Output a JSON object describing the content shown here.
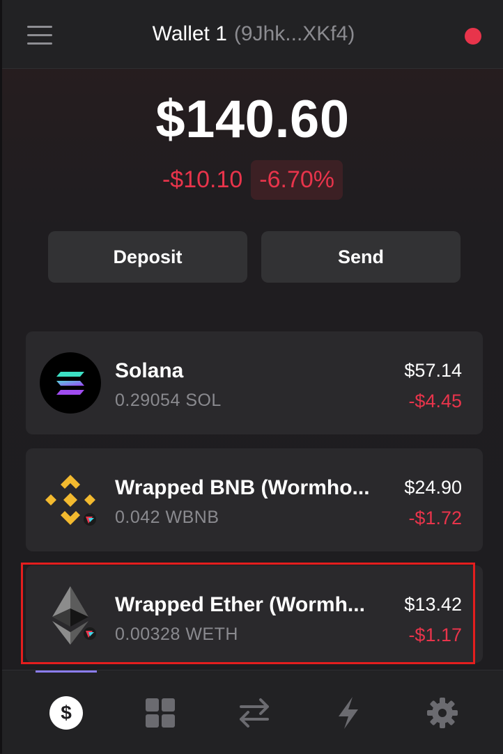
{
  "header": {
    "wallet_name": "Wallet 1",
    "wallet_address": "(9Jhk...XKf4)",
    "status_color": "#e8344b"
  },
  "balance": {
    "total": "$140.60",
    "change_amount": "-$10.10",
    "change_percent": "-6.70%"
  },
  "actions": {
    "deposit_label": "Deposit",
    "send_label": "Send"
  },
  "tokens": [
    {
      "name": "Solana",
      "amount": "0.29054 SOL",
      "value": "$57.14",
      "change": "-$4.45",
      "icon": "solana-icon"
    },
    {
      "name": "Wrapped BNB (Wormho...",
      "amount": "0.042 WBNB",
      "value": "$24.90",
      "change": "-$1.72",
      "icon": "bnb-icon"
    },
    {
      "name": "Wrapped Ether (Wormh...",
      "amount": "0.00328 WETH",
      "value": "$13.42",
      "change": "-$1.17",
      "icon": "ethereum-icon"
    }
  ],
  "nav": {
    "items": [
      "dollar-icon",
      "apps-grid-icon",
      "swap-icon",
      "lightning-icon",
      "gear-icon"
    ],
    "active": "dollar-icon"
  },
  "colors": {
    "accent": "#8b7df2",
    "negative": "#e8344b",
    "highlight": "#e41e1e"
  }
}
